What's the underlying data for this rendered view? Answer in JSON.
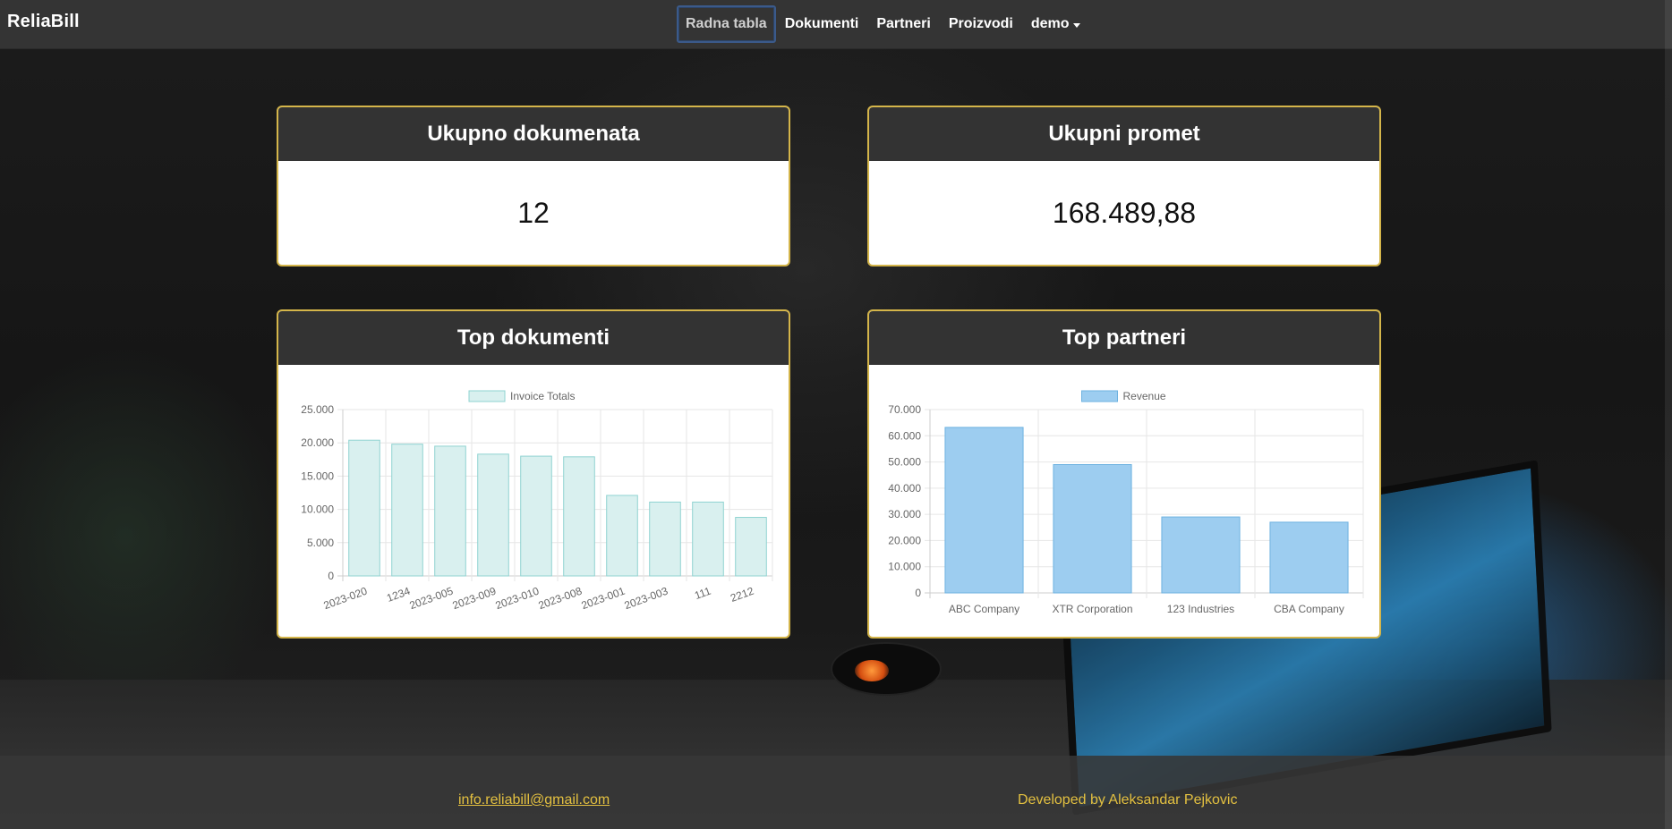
{
  "navbar": {
    "brand": "ReliaBill",
    "items": [
      {
        "label": "Radna tabla",
        "active": true
      },
      {
        "label": "Dokumenti",
        "active": false
      },
      {
        "label": "Partneri",
        "active": false
      },
      {
        "label": "Proizvodi",
        "active": false
      },
      {
        "label": "demo",
        "active": false,
        "dropdown": true
      }
    ]
  },
  "cards": {
    "total_docs": {
      "title": "Ukupno dokumenata",
      "value": "12"
    },
    "total_revenue": {
      "title": "Ukupni promet",
      "value": "168.489,88"
    },
    "top_docs": {
      "title": "Top dokumenti"
    },
    "top_partners": {
      "title": "Top partneri"
    }
  },
  "chart_data": [
    {
      "type": "bar",
      "title": "",
      "categories": [
        "2023-020",
        "1234",
        "2023-005",
        "2023-009",
        "2023-010",
        "2023-008",
        "2023-001",
        "2023-003",
        "111",
        "2212"
      ],
      "series": [
        {
          "name": "Invoice Totals",
          "values": [
            20400,
            19800,
            19500,
            18300,
            18000,
            17900,
            12100,
            11100,
            11100,
            8800
          ]
        }
      ],
      "ylim": [
        0,
        25000
      ],
      "yticks": [
        "0",
        "5.000",
        "10.000",
        "15.000",
        "20.000",
        "25.000"
      ],
      "color": "#8fd3d1",
      "fill": "#d9f0ef",
      "grid": true,
      "legend": "top"
    },
    {
      "type": "bar",
      "title": "",
      "categories": [
        "ABC Company",
        "XTR Corporation",
        "123 Industries",
        "CBA Company"
      ],
      "series": [
        {
          "name": "Revenue",
          "values": [
            63200,
            49000,
            29000,
            27000
          ]
        }
      ],
      "ylim": [
        0,
        70000
      ],
      "yticks": [
        "0",
        "10.000",
        "20.000",
        "30.000",
        "40.000",
        "50.000",
        "60.000",
        "70.000"
      ],
      "color": "#6eb2e0",
      "fill": "#9dcdf0",
      "grid": true,
      "legend": "top"
    }
  ],
  "footer": {
    "email": "info.reliabill@gmail.com",
    "developer": "Developed by Aleksandar Pejkovic"
  }
}
